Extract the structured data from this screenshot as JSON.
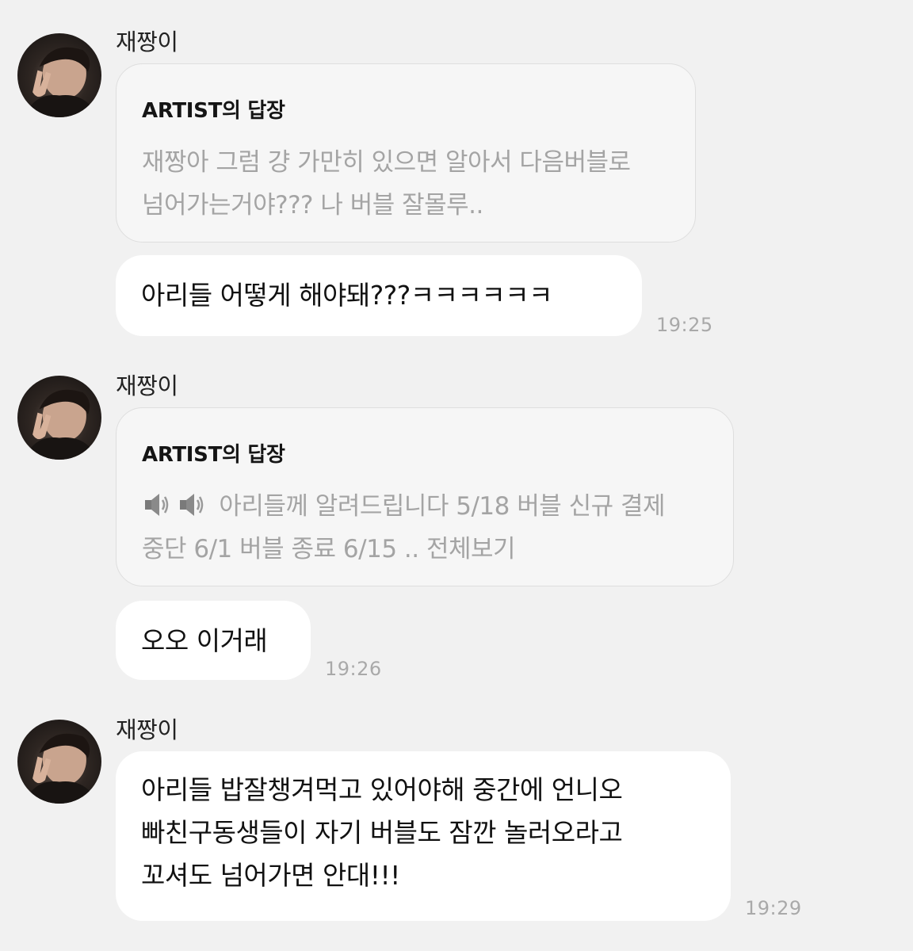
{
  "messages": [
    {
      "sender": "재짱이",
      "reply_title": "ARTIST의 답장",
      "reply_lines": [
        "재짱아 그럼 걍 가만히 있으면 알아서 다음버블로",
        "넘어가는거야??? 나 버블 잘몰루.."
      ],
      "message": "아리들 어떻게 해야돼???ㅋㅋㅋㅋㅋㅋ",
      "time": "19:25"
    },
    {
      "sender": "재짱이",
      "reply_title": "ARTIST의 답장",
      "reply_icons": [
        "speaker-icon",
        "speaker-icon"
      ],
      "reply_lines": [
        "아리들께 알려드립니다 5/18 버블 신규 결제",
        "중단 6/1 버블 종료 6/15 .. 전체보기"
      ],
      "message": "오오 이거래",
      "time": "19:26"
    },
    {
      "sender": "재짱이",
      "message_lines": [
        "아리들 밥잘챙겨먹고 있어야해 중간에 언니오",
        "빠친구동생들이 자기 버블도 잠깐 놀러오라고",
        "꼬셔도 넘어가면 안대!!!"
      ],
      "time": "19:29"
    }
  ],
  "colors": {
    "background": "#f1f1f1",
    "bubble": "#ffffff",
    "reply_bubble": "#f6f6f6",
    "muted_text": "#a4a4a4",
    "timestamp": "#a9a9a9"
  }
}
